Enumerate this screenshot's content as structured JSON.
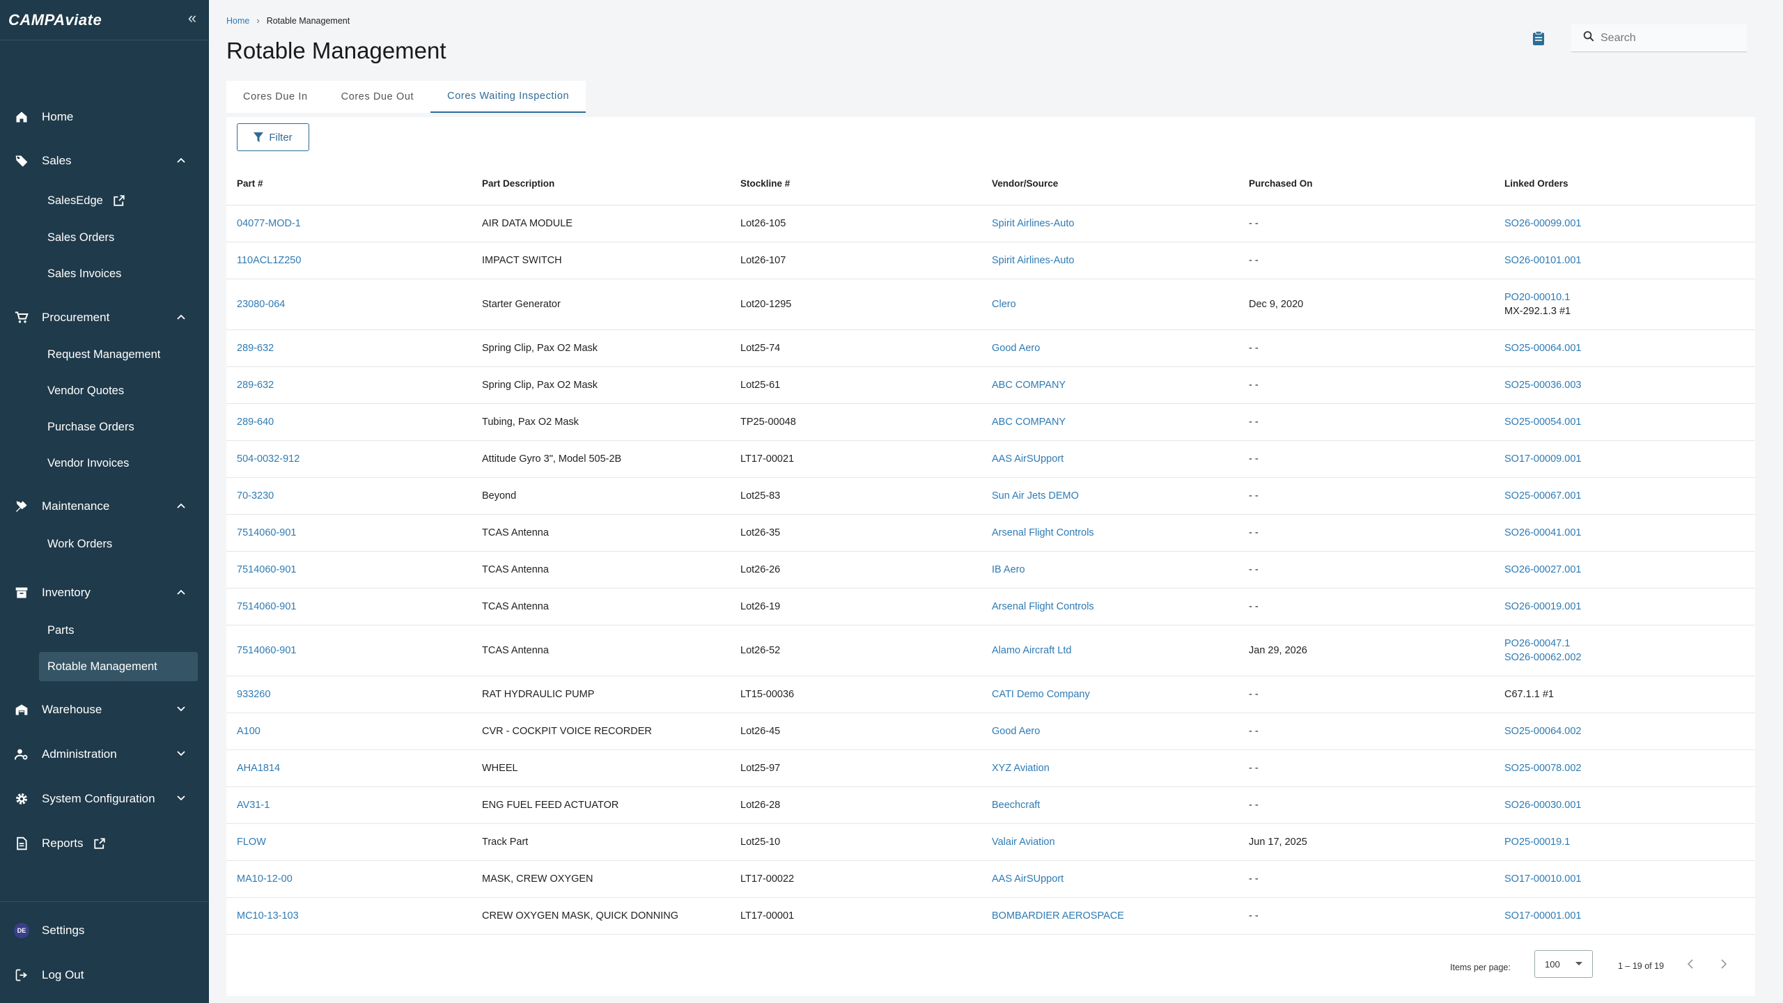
{
  "app": {
    "logo_text": "CAMPAviate"
  },
  "sidebar": {
    "items": [
      {
        "label": "Home",
        "icon": "home-icon"
      },
      {
        "label": "Sales",
        "icon": "tag-icon",
        "expanded": true,
        "children": [
          {
            "label": "SalesEdge",
            "external": true
          },
          {
            "label": "Sales Orders"
          },
          {
            "label": "Sales Invoices"
          }
        ]
      },
      {
        "label": "Procurement",
        "icon": "cart-icon",
        "expanded": true,
        "children": [
          {
            "label": "Request Management"
          },
          {
            "label": "Vendor Quotes"
          },
          {
            "label": "Purchase Orders"
          },
          {
            "label": "Vendor Invoices"
          }
        ]
      },
      {
        "label": "Maintenance",
        "icon": "tools-icon",
        "expanded": true,
        "children": [
          {
            "label": "Work Orders"
          }
        ]
      },
      {
        "label": "Inventory",
        "icon": "archive-icon",
        "expanded": true,
        "children": [
          {
            "label": "Parts"
          },
          {
            "label": "Rotable Management",
            "active": true
          }
        ]
      },
      {
        "label": "Warehouse",
        "icon": "warehouse-icon",
        "expanded": false
      },
      {
        "label": "Administration",
        "icon": "admin-icon",
        "expanded": false
      },
      {
        "label": "System Configuration",
        "icon": "gear-icon",
        "expanded": false
      },
      {
        "label": "Reports",
        "icon": "report-icon",
        "external": true
      }
    ],
    "settings_label": "Settings",
    "avatar_initials": "DE",
    "logout_label": "Log Out"
  },
  "breadcrumb": {
    "home": "Home",
    "current": "Rotable Management"
  },
  "page_title": "Rotable Management",
  "search": {
    "placeholder": "Search"
  },
  "tabs": [
    {
      "label": "Cores Due In",
      "active": false
    },
    {
      "label": "Cores Due Out",
      "active": false
    },
    {
      "label": "Cores Waiting Inspection",
      "active": true
    }
  ],
  "filter_label": "Filter",
  "table": {
    "columns": [
      "Part #",
      "Part Description",
      "Stockline #",
      "Vendor/Source",
      "Purchased On",
      "Linked Orders"
    ],
    "rows": [
      {
        "part": "04077-MOD-1",
        "desc": "AIR DATA MODULE",
        "stockline": "Lot26-105",
        "vendor": "Spirit Airlines-Auto",
        "purchased": "- -",
        "linked": [
          {
            "text": "SO26-00099.001",
            "link": true
          }
        ]
      },
      {
        "part": "110ACL1Z250",
        "desc": "IMPACT SWITCH",
        "stockline": "Lot26-107",
        "vendor": "Spirit Airlines-Auto",
        "purchased": "- -",
        "linked": [
          {
            "text": "SO26-00101.001",
            "link": true
          }
        ]
      },
      {
        "part": "23080-064",
        "desc": "Starter Generator",
        "stockline": "Lot20-1295",
        "vendor": "Clero",
        "purchased": "Dec 9, 2020",
        "linked": [
          {
            "text": "PO20-00010.1",
            "link": true
          },
          {
            "text": "MX-292.1.3 #1",
            "link": false
          }
        ]
      },
      {
        "part": "289-632",
        "desc": "Spring Clip, Pax O2 Mask",
        "stockline": "Lot25-74",
        "vendor": "Good Aero",
        "purchased": "- -",
        "linked": [
          {
            "text": "SO25-00064.001",
            "link": true
          }
        ]
      },
      {
        "part": "289-632",
        "desc": "Spring Clip, Pax O2 Mask",
        "stockline": "Lot25-61",
        "vendor": "ABC COMPANY",
        "purchased": "- -",
        "linked": [
          {
            "text": "SO25-00036.003",
            "link": true
          }
        ]
      },
      {
        "part": "289-640",
        "desc": "Tubing, Pax O2 Mask",
        "stockline": "TP25-00048",
        "vendor": "ABC COMPANY",
        "purchased": "- -",
        "linked": [
          {
            "text": "SO25-00054.001",
            "link": true
          }
        ]
      },
      {
        "part": "504-0032-912",
        "desc": "Attitude Gyro 3\", Model 505-2B",
        "stockline": "LT17-00021",
        "vendor": "AAS AirSUpport",
        "purchased": "- -",
        "linked": [
          {
            "text": "SO17-00009.001",
            "link": true
          }
        ]
      },
      {
        "part": "70-3230",
        "desc": "Beyond",
        "stockline": "Lot25-83",
        "vendor": "Sun Air Jets DEMO",
        "purchased": "- -",
        "linked": [
          {
            "text": "SO25-00067.001",
            "link": true
          }
        ]
      },
      {
        "part": "7514060-901",
        "desc": "TCAS Antenna",
        "stockline": "Lot26-35",
        "vendor": "Arsenal Flight Controls",
        "purchased": "- -",
        "linked": [
          {
            "text": "SO26-00041.001",
            "link": true
          }
        ]
      },
      {
        "part": "7514060-901",
        "desc": "TCAS Antenna",
        "stockline": "Lot26-26",
        "vendor": "IB Aero",
        "purchased": "- -",
        "linked": [
          {
            "text": "SO26-00027.001",
            "link": true
          }
        ]
      },
      {
        "part": "7514060-901",
        "desc": "TCAS Antenna",
        "stockline": "Lot26-19",
        "vendor": "Arsenal Flight Controls",
        "purchased": "- -",
        "linked": [
          {
            "text": "SO26-00019.001",
            "link": true
          }
        ]
      },
      {
        "part": "7514060-901",
        "desc": "TCAS Antenna",
        "stockline": "Lot26-52",
        "vendor": "Alamo Aircraft Ltd",
        "purchased": "Jan 29, 2026",
        "linked": [
          {
            "text": "PO26-00047.1",
            "link": true
          },
          {
            "text": "SO26-00062.002",
            "link": true
          }
        ]
      },
      {
        "part": "933260",
        "desc": "RAT HYDRAULIC PUMP",
        "stockline": "LT15-00036",
        "vendor": "CATI Demo Company",
        "purchased": "- -",
        "linked": [
          {
            "text": "C67.1.1 #1",
            "link": false
          }
        ]
      },
      {
        "part": "A100",
        "desc": "CVR - COCKPIT VOICE RECORDER",
        "stockline": "Lot26-45",
        "vendor": "Good Aero",
        "purchased": "- -",
        "linked": [
          {
            "text": "SO25-00064.002",
            "link": true
          }
        ]
      },
      {
        "part": "AHA1814",
        "desc": "WHEEL",
        "stockline": "Lot25-97",
        "vendor": "XYZ Aviation",
        "purchased": "- -",
        "linked": [
          {
            "text": "SO25-00078.002",
            "link": true
          }
        ]
      },
      {
        "part": "AV31-1",
        "desc": "ENG FUEL FEED ACTUATOR",
        "stockline": "Lot26-28",
        "vendor": "Beechcraft",
        "purchased": "- -",
        "linked": [
          {
            "text": "SO26-00030.001",
            "link": true
          }
        ]
      },
      {
        "part": "FLOW",
        "desc": "Track Part",
        "stockline": "Lot25-10",
        "vendor": "Valair Aviation",
        "purchased": "Jun 17, 2025",
        "linked": [
          {
            "text": "PO25-00019.1",
            "link": true
          }
        ]
      },
      {
        "part": "MA10-12-00",
        "desc": "MASK, CREW OXYGEN",
        "stockline": "LT17-00022",
        "vendor": "AAS AirSUpport",
        "purchased": "- -",
        "linked": [
          {
            "text": "SO17-00010.001",
            "link": true
          }
        ]
      },
      {
        "part": "MC10-13-103",
        "desc": "CREW OXYGEN MASK, QUICK DONNING",
        "stockline": "LT17-00001",
        "vendor": "BOMBARDIER AEROSPACE",
        "purchased": "- -",
        "linked": [
          {
            "text": "SO17-00001.001",
            "link": true
          }
        ]
      }
    ]
  },
  "paginator": {
    "items_per_page_label": "Items per page:",
    "page_size": "100",
    "range_label": "1 – 19 of 19"
  },
  "colors": {
    "sidebar_bg": "#1f3a4a",
    "link": "#2e7bb4",
    "accent": "#2e6c93",
    "active_nav_bg": "#355466"
  }
}
